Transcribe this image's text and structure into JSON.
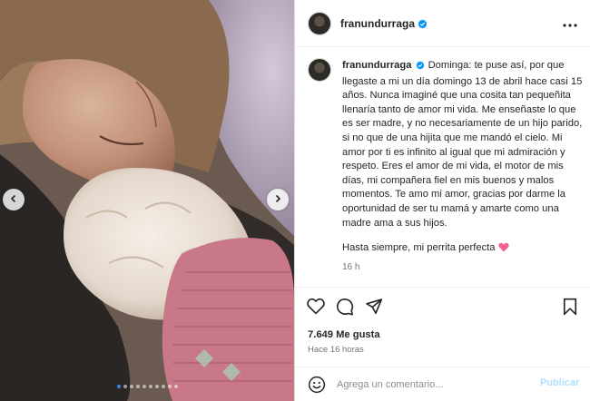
{
  "post": {
    "username": "franundurraga",
    "verified": true,
    "caption": "Dominga: te puse así, por que llegaste a mi un día domingo 13 de abril hace casi 15 años. Nunca imaginé que una cosita tan pequeñita llenaría tanto de amor mi vida. Me enseñaste lo que es ser madre, y no necesariamente de un hijo parido, si no que de una hijita que me mandó el cielo. Mi amor por ti es infinito al igual que mi admiración y respeto. Eres el amor de mi vida, el motor de mis días, mi compañera fiel en mis buenos y malos momentos. Te amo mi amor, gracias por darme la oportunidad de ser tu mamá y amarte como una madre ama a sus hijos.",
    "signoff": "Hasta siempre, mi perrita perfecta",
    "signoff_emoji": "pink-heart-emoji",
    "time_short": "16 h",
    "likes": "7.649 Me gusta",
    "posted_ago": "Hace 16 horas"
  },
  "carousel": {
    "slide_count": 10,
    "active_index": 0,
    "accent_color": "#3b82f6"
  },
  "comment": {
    "placeholder": "Agrega un comentario...",
    "value": "",
    "publish_label": "Publicar"
  },
  "icons": {
    "like": "heart-outline-icon",
    "comment": "comment-bubble-icon",
    "share": "paper-plane-icon",
    "save": "bookmark-icon",
    "more": "more-options-icon",
    "emoji": "smiley-face-icon"
  },
  "colors": {
    "verified_badge": "#0095f6",
    "publish_disabled": "#b2dffc",
    "heart_emoji": "#f06292"
  }
}
